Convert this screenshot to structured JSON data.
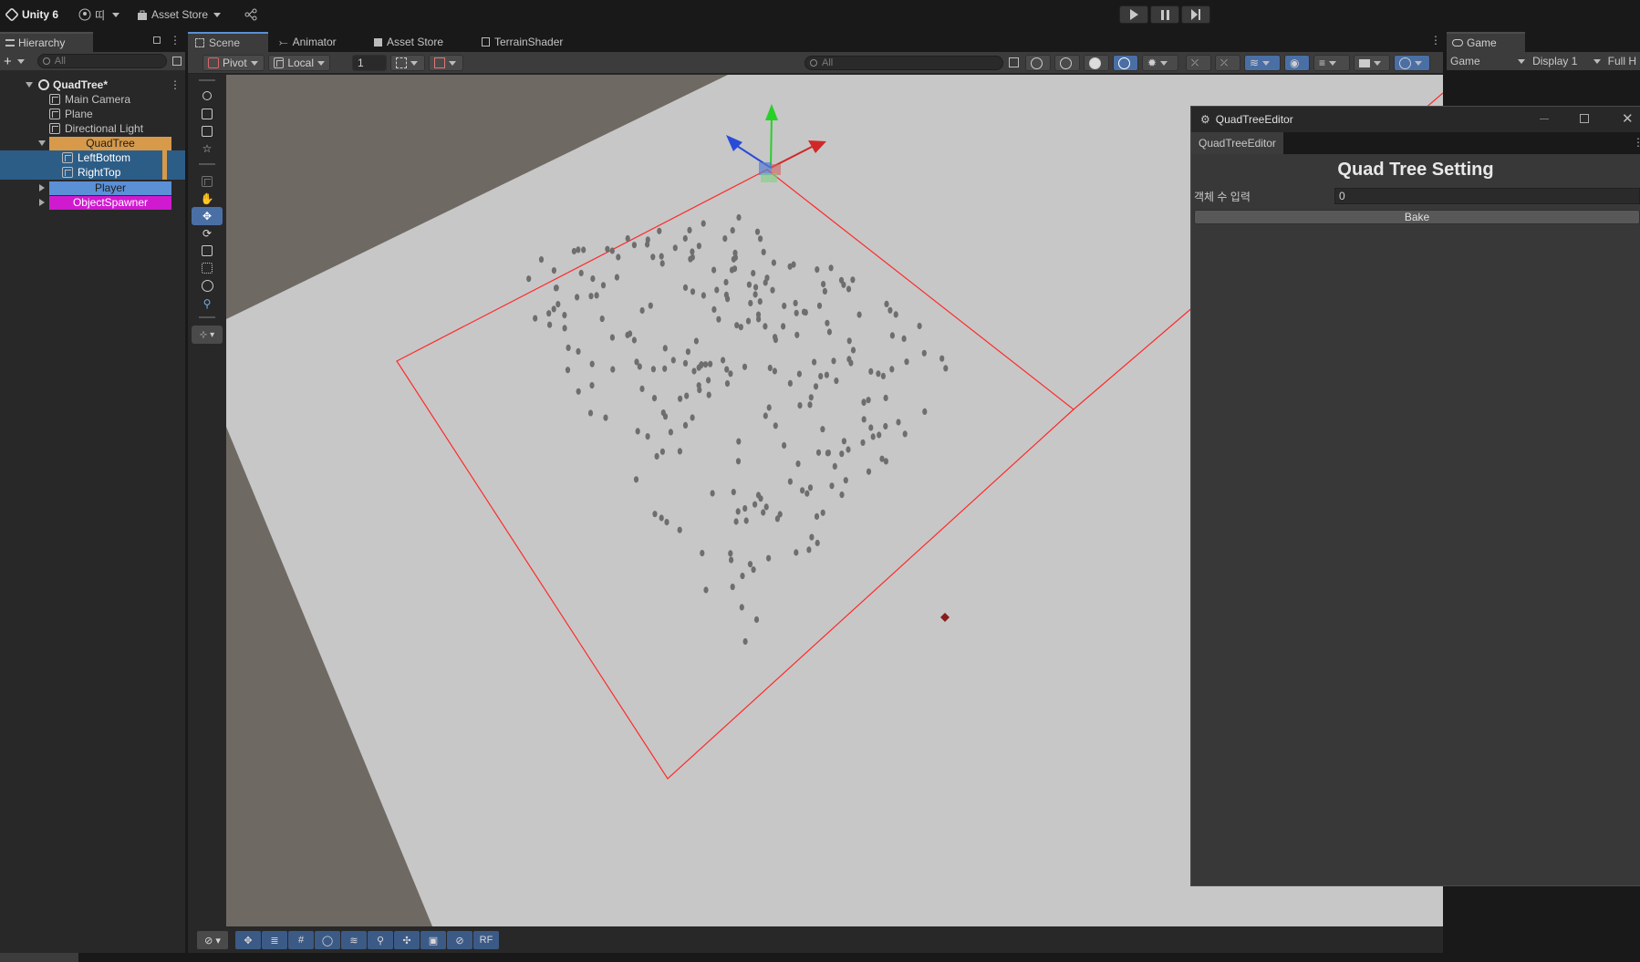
{
  "topbar": {
    "app_title": "Unity 6",
    "account_label": "띠",
    "asset_store_label": "Asset Store"
  },
  "hierarchy": {
    "tab_label": "Hierarchy",
    "search_placeholder": "All",
    "items": [
      {
        "label": "QuadTree*",
        "depth": 0
      },
      {
        "label": "Main Camera",
        "depth": 1
      },
      {
        "label": "Plane",
        "depth": 1
      },
      {
        "label": "Directional Light",
        "depth": 1
      },
      {
        "label": "QuadTree",
        "depth": 1
      },
      {
        "label": "LeftBottom",
        "depth": 2
      },
      {
        "label": "RightTop",
        "depth": 2
      },
      {
        "label": "Player",
        "depth": 1
      },
      {
        "label": "ObjectSpawner",
        "depth": 1
      }
    ],
    "colors": {
      "quadtree": "#d69a4a",
      "player": "#5b8fd6",
      "objectspawner": "#d01ad0",
      "selected": "#2c5d87"
    }
  },
  "scene": {
    "tabs": [
      "Scene",
      "Animator",
      "Asset Store",
      "TerrainShader"
    ],
    "pivot_label": "Pivot",
    "local_label": "Local",
    "grid_value": "1",
    "search_placeholder": "All",
    "rf_label": "RF"
  },
  "game": {
    "tab_label": "Game",
    "mode_label": "Game",
    "display_label": "Display 1",
    "full_label": "Full H"
  },
  "editor": {
    "window_title": "QuadTreeEditor",
    "tab_label": "QuadTreeEditor",
    "heading": "Quad Tree Setting",
    "field_label": "객체 수 입력",
    "field_value": "0",
    "bake_label": "Bake"
  },
  "colors": {
    "accent": "#4a6fa5",
    "bounds_line": "#ff2a2a"
  }
}
